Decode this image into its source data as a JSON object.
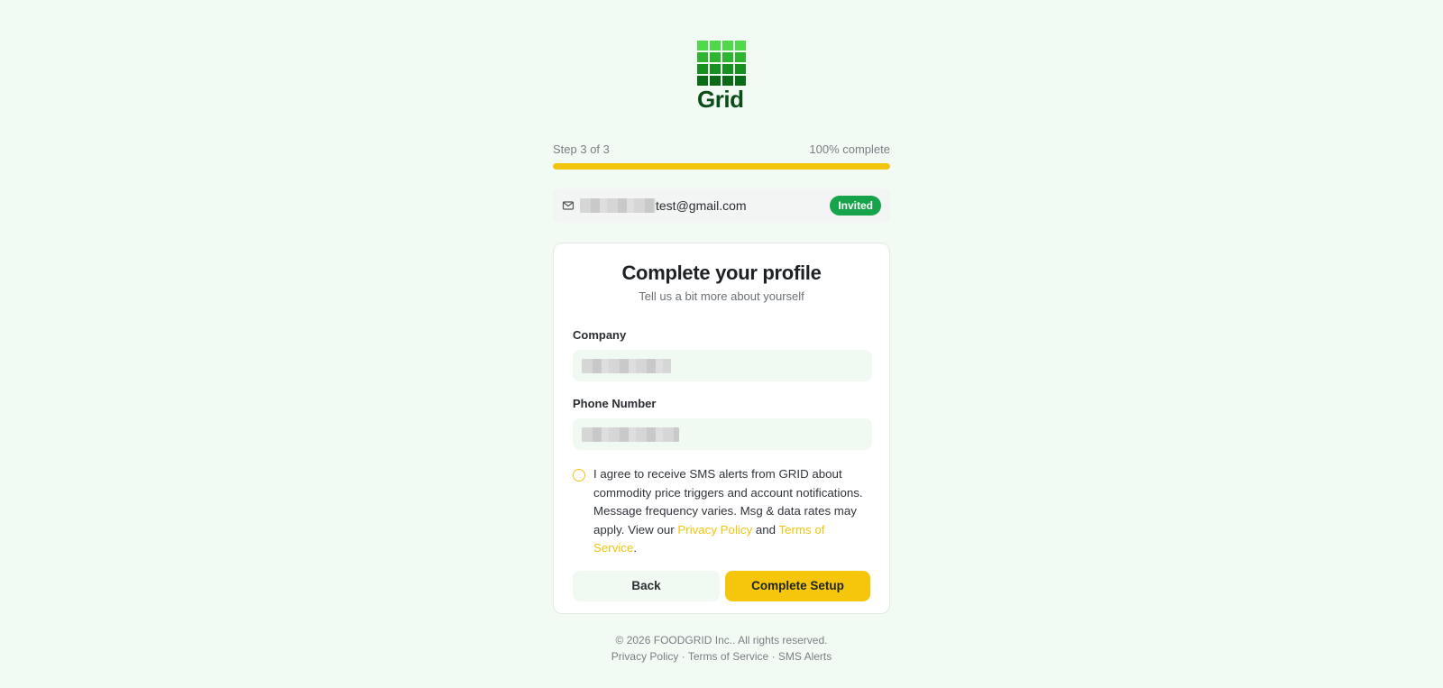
{
  "brand": {
    "name": "Grid",
    "colors": {
      "logo_dark": "#0b4d17",
      "accent": "#f2c40d",
      "badge": "#16a34a"
    }
  },
  "progress": {
    "step_text": "Step 3 of 3",
    "percent_text": "100% complete",
    "fraction": 1.0
  },
  "account": {
    "email_visible_part": "test@gmail.com",
    "status_badge": "Invited",
    "icon": "mail-icon"
  },
  "form": {
    "title": "Complete your profile",
    "subtitle": "Tell us a bit more about yourself",
    "company_label": "Company",
    "phone_label": "Phone Number"
  },
  "consent": {
    "text_before": "I agree to receive SMS alerts from GRID about commodity price triggers and account notifications. Message frequency varies. Msg & data rates may apply. View our ",
    "privacy_link": "Privacy Policy",
    "and_text": " and ",
    "terms_link": "Terms of Service",
    "end_text": "."
  },
  "buttons": {
    "back": "Back",
    "submit": "Complete Setup"
  },
  "footer": {
    "copyright": "© 2026 FOODGRID Inc.. All rights reserved.",
    "links": [
      "Privacy Policy",
      "Terms of Service",
      "SMS Alerts"
    ],
    "separator": " · "
  }
}
